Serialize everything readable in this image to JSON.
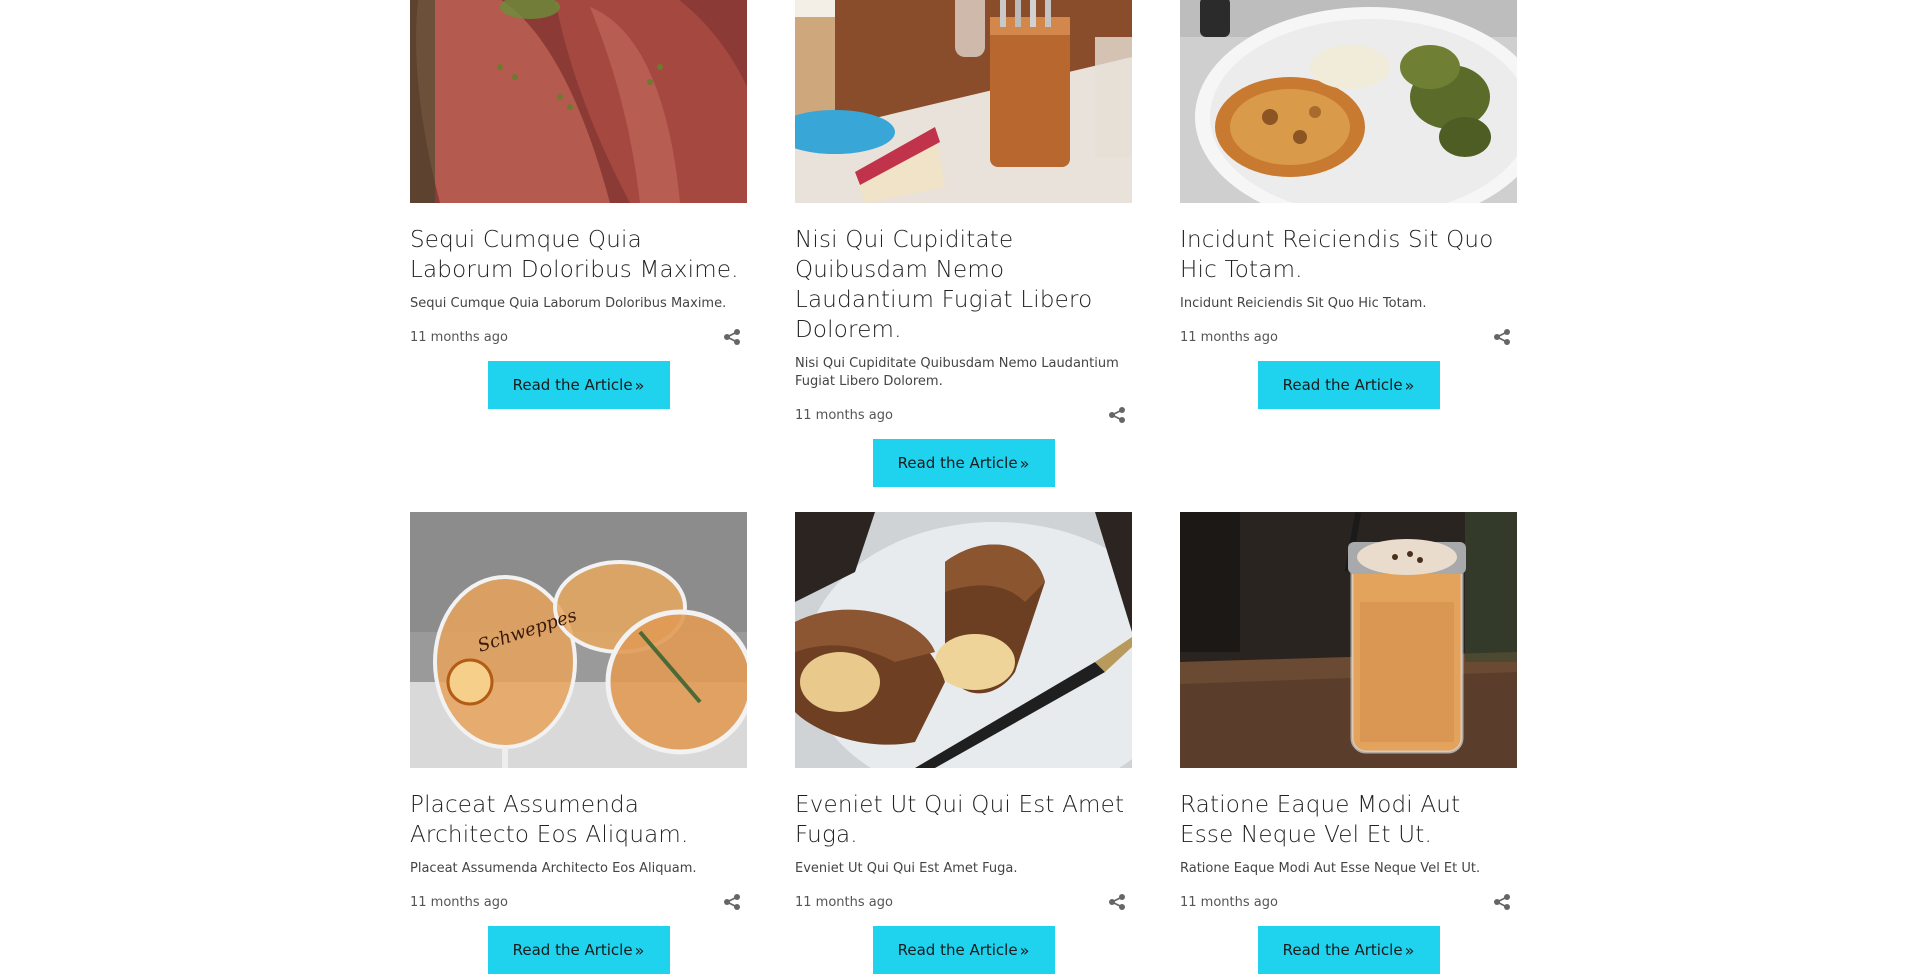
{
  "articles": [
    {
      "title": "Sequi Cumque Quia Laborum Doloribus Maxime.",
      "excerpt": "Sequi Cumque Quia Laborum Doloribus Maxime.",
      "date": "11 months ago",
      "cta": "Read the Article",
      "image": "raw-meat-steaks"
    },
    {
      "title": "Nisi Qui Cupiditate Quibusdam Nemo Laudantium Fugiat Libero Dolorem.",
      "excerpt": "Nisi Qui Cupiditate Quibusdam Nemo Laudantium Fugiat Libero Dolorem.",
      "date": "11 months ago",
      "cta": "Read the Article",
      "image": "cafe-table-cutlery"
    },
    {
      "title": "Incidunt Reiciendis Sit Quo Hic Totam.",
      "excerpt": "Incidunt Reiciendis Sit Quo Hic Totam.",
      "date": "11 months ago",
      "cta": "Read the Article",
      "image": "plated-dish"
    },
    {
      "title": "Placeat Assumenda Architecto Eos Aliquam.",
      "excerpt": "Placeat Assumenda Architecto Eos Aliquam.",
      "date": "11 months ago",
      "cta": "Read the Article",
      "image": "cocktails",
      "image_label": "Schweppes"
    },
    {
      "title": "Eveniet Ut Qui Qui Est Amet Fuga.",
      "excerpt": "Eveniet Ut Qui Qui Est Amet Fuga.",
      "date": "11 months ago",
      "cta": "Read the Article",
      "image": "eclairs"
    },
    {
      "title": "Ratione Eaque Modi Aut Esse Neque Vel Et Ut.",
      "excerpt": "Ratione Eaque Modi Aut Esse Neque Vel Et Ut.",
      "date": "11 months ago",
      "cta": "Read the Article",
      "image": "iced-coffee-jar"
    }
  ],
  "colors": {
    "button": "#1fd2ee",
    "text": "#222222",
    "meta": "#555555"
  },
  "icons": {
    "share": "share-icon",
    "arrows": "double-chevron-right-icon"
  }
}
